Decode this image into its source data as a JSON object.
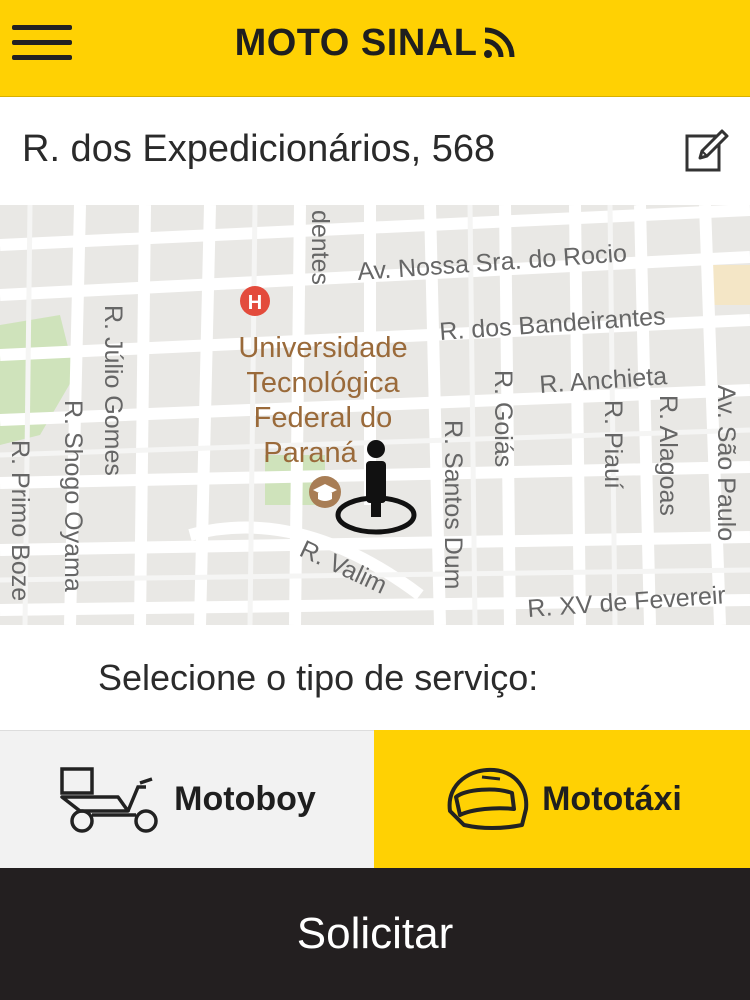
{
  "header": {
    "title": "MOTO SINAL",
    "menu_icon": "hamburger-menu-icon",
    "signal_icon": "signal-rss-icon"
  },
  "address": {
    "text": "R. dos Expedicionários, 568",
    "edit_icon": "edit-pencil-icon"
  },
  "map": {
    "streets": {
      "rocio": "Av. Nossa Sra. do Rocio",
      "bandeirantes": "R. dos Bandeirantes",
      "anchieta": "R. Anchieta",
      "julio": "R. Júlio Gomes",
      "shogo": "R. Shogo Oyama",
      "primo": "R. Primo Boze",
      "goias": "R. Goiás",
      "santos": "R. Santos Dum",
      "piaui": "R. Piauí",
      "alagoas": "R. Alagoas",
      "saopaulo": "Av. São Paulo",
      "valim": "R. Valim",
      "xv": "R. XV de Fevereir",
      "dentes": "dentes"
    },
    "poi": {
      "line1": "Universidade",
      "line2": "Tecnológica",
      "line3": "Federal do",
      "line4": "Paraná",
      "hospital_letter": "H"
    }
  },
  "service": {
    "prompt": "Selecione o tipo de serviço:",
    "options": [
      {
        "label": "Motoboy",
        "icon": "motoboy-scooter-icon",
        "selected": false
      },
      {
        "label": "Mototáxi",
        "icon": "helmet-icon",
        "selected": true
      }
    ]
  },
  "request_button": {
    "label": "Solicitar"
  },
  "colors": {
    "accent": "#ffd103",
    "dark": "#231f20"
  }
}
